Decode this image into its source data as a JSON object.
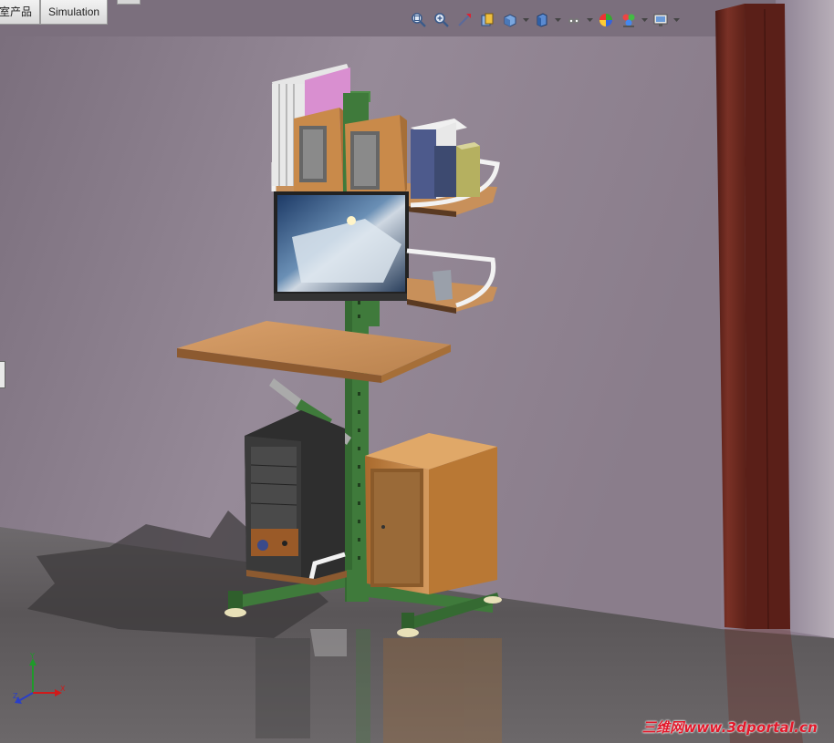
{
  "tabs": [
    {
      "label": "室产品",
      "active": false
    },
    {
      "label": "Simulation",
      "active": false
    }
  ],
  "heads_up_toolbar": {
    "icons": [
      "zoom-to-fit-icon",
      "zoom-to-area-icon",
      "previous-view-icon",
      "section-view-icon",
      "view-orientation-icon",
      "display-style-icon",
      "hide-show-items-icon",
      "edit-appearance-icon",
      "apply-scene-icon",
      "view-settings-icon"
    ]
  },
  "model": {
    "name": "computer-desk-assembly",
    "colors": {
      "wall": "#8f8392",
      "floor": "#5f5a5c",
      "frame": "#3f7a3b",
      "wood": "#c98a4a",
      "cabinet": "#b97834",
      "pillar": "#6e2b22"
    }
  },
  "coordinate_triad": {
    "axes": [
      "Y",
      "Z",
      "X"
    ]
  },
  "watermark": {
    "text": "三维网www.3dportal.cn"
  }
}
